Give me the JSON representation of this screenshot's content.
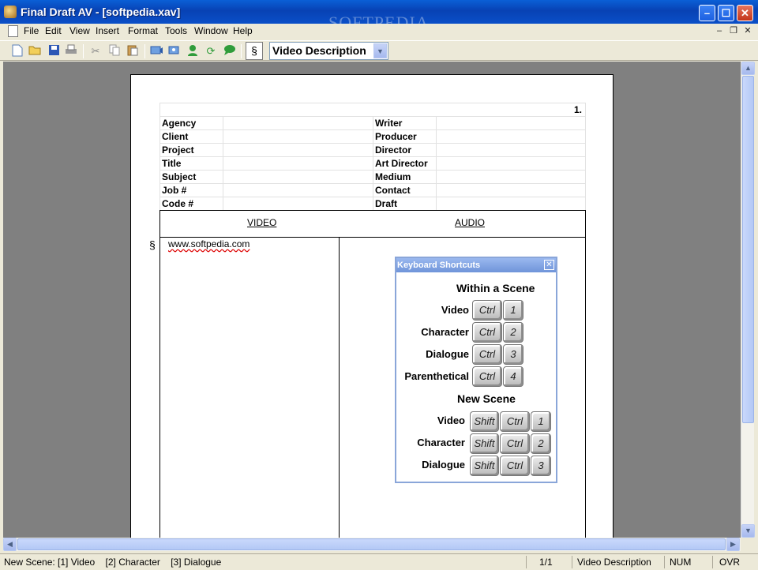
{
  "window": {
    "title": "Final Draft AV - [softpedia.xav]",
    "watermark": "SOFTPEDIA",
    "minimize": "–",
    "maximize": "☐",
    "close": "✕"
  },
  "menu": [
    "File",
    "Edit",
    "View",
    "Insert",
    "Format",
    "Tools",
    "Window",
    "Help"
  ],
  "mdi_controls": [
    "–",
    "❐",
    "✕"
  ],
  "toolbar": {
    "icons": [
      "new-document-icon",
      "open-folder-icon",
      "save-disk-icon",
      "print-icon",
      "cut-scissors-icon",
      "copy-icon",
      "paste-icon",
      "scene-icon",
      "shot-icon",
      "character-icon",
      "refresh-icon",
      "chat-icon"
    ],
    "section_symbol": "§",
    "element_select": "Video Description"
  },
  "header": {
    "page_number": "1.",
    "left_labels": [
      "Agency",
      "Client",
      "Project",
      "Title",
      "Subject",
      "Job #",
      "Code #"
    ],
    "right_labels": [
      "Writer",
      "Producer",
      "Director",
      "Art Director",
      "Medium",
      "Contact",
      "Draft"
    ]
  },
  "av": {
    "video_heading": "VIDEO",
    "audio_heading": "AUDIO",
    "section_mark": "§",
    "video_text": "www.softpedia.com"
  },
  "shortcuts": {
    "title": "Keyboard Shortcuts",
    "within_heading": "Within a Scene",
    "new_heading": "New Scene",
    "within": [
      {
        "label": "Video",
        "keys": [
          "Ctrl",
          "1"
        ]
      },
      {
        "label": "Character",
        "keys": [
          "Ctrl",
          "2"
        ]
      },
      {
        "label": "Dialogue",
        "keys": [
          "Ctrl",
          "3"
        ]
      },
      {
        "label": "Parenthetical",
        "keys": [
          "Ctrl",
          "4"
        ]
      }
    ],
    "new": [
      {
        "label": "Video",
        "keys": [
          "Shift",
          "Ctrl",
          "1"
        ]
      },
      {
        "label": "Character",
        "keys": [
          "Shift",
          "Ctrl",
          "2"
        ]
      },
      {
        "label": "Dialogue",
        "keys": [
          "Shift",
          "Ctrl",
          "3"
        ]
      }
    ]
  },
  "status": {
    "hint": "New Scene: [1] Video    [2] Character    [3] Dialogue",
    "page": "1/1",
    "element": "Video Description",
    "num": "NUM",
    "ovr": "OVR"
  }
}
